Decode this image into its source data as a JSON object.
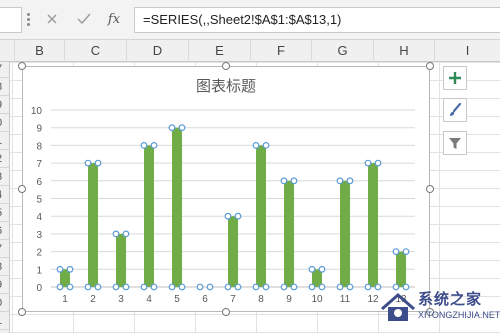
{
  "formula_bar": {
    "formula": "=SERIES(,,Sheet2!$A$1:$A$13,1)",
    "fx_label": "fx"
  },
  "columns": [
    "B",
    "C",
    "D",
    "E",
    "F",
    "G",
    "H",
    "I"
  ],
  "row_numbers": [
    "7",
    "8",
    "9",
    "0",
    "1",
    "2",
    "3",
    "4",
    "5",
    "6",
    "7",
    "8",
    "9",
    "0",
    "1",
    "2"
  ],
  "chart_data": {
    "type": "bar",
    "title": "图表标题",
    "categories": [
      "1",
      "2",
      "3",
      "4",
      "5",
      "6",
      "7",
      "8",
      "9",
      "10",
      "11",
      "12",
      "13"
    ],
    "values": [
      1,
      7,
      3,
      8,
      9,
      0,
      4,
      8,
      6,
      1,
      6,
      7,
      2
    ],
    "ylim": [
      0,
      10
    ],
    "yticks": [
      "0",
      "1",
      "2",
      "3",
      "4",
      "5",
      "6",
      "7",
      "8",
      "9",
      "10"
    ],
    "grid": true,
    "bar_color": "#70ad47",
    "series_selected": true
  },
  "side_tools": [
    "plus-icon",
    "brush-icon",
    "filter-icon"
  ],
  "watermark": {
    "title": "系统之家",
    "subtitle": "XITONGZHIJIA.NET"
  }
}
